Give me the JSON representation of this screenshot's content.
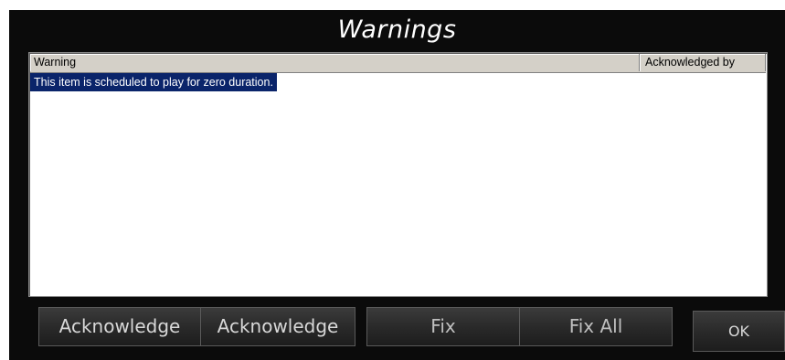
{
  "window": {
    "title": "Warnings"
  },
  "list": {
    "columns": [
      "Warning",
      "Acknowledged by"
    ],
    "rows": [
      {
        "warning": "This item is scheduled to play for zero duration.",
        "acknowledged_by": ""
      }
    ]
  },
  "buttons": {
    "acknowledge_1": "Acknowledge",
    "acknowledge_2": "Acknowledge",
    "fix": "Fix",
    "fix_all": "Fix All",
    "ok": "OK"
  },
  "colors": {
    "background": "#0b0b0b",
    "selection": "#0a246a",
    "header": "#d4d0c8"
  }
}
